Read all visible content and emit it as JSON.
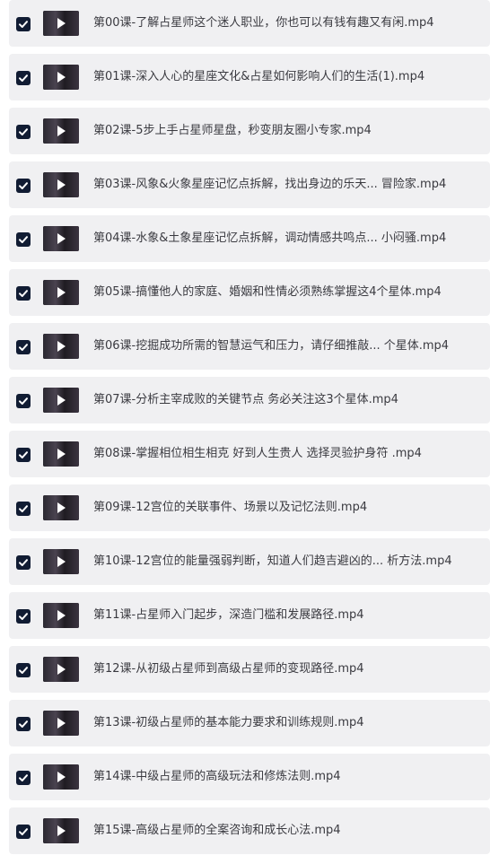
{
  "files": [
    {
      "name": "第00课-了解占星师这个迷人职业，你也可以有钱有趣又有闲.mp4",
      "checked": true
    },
    {
      "name": "第01课-深入人心的星座文化&占星如何影响人们的生活(1).mp4",
      "checked": true
    },
    {
      "name": "第02课-5步上手占星师星盘，秒变朋友圈小专家.mp4",
      "checked": true
    },
    {
      "name": "第03课-风象&火象星座记忆点拆解，找出身边的乐天... 冒险家.mp4",
      "checked": true
    },
    {
      "name": "第04课-水象&土象星座记忆点拆解，调动情感共鸣点... 小闷骚.mp4",
      "checked": true
    },
    {
      "name": "第05课-搞懂他人的家庭、婚姻和性情必须熟练掌握这4个星体.mp4",
      "checked": true
    },
    {
      "name": "第06课-挖掘成功所需的智慧运气和压力，请仔细推敲... 个星体.mp4",
      "checked": true
    },
    {
      "name": "第07课-分析主宰成败的关键节点 务必关注这3个星体.mp4",
      "checked": true
    },
    {
      "name": "第08课-掌握相位相生相克 好到人生贵人 选择灵验护身符 .mp4",
      "checked": true
    },
    {
      "name": "第09课-12宫位的关联事件、场景以及记忆法则.mp4",
      "checked": true
    },
    {
      "name": "第10课-12宫位的能量强弱判断，知道人们趋吉避凶的... 析方法.mp4",
      "checked": true
    },
    {
      "name": "第11课-占星师入门起步，深造门槛和发展路径.mp4",
      "checked": true
    },
    {
      "name": "第12课-从初级占星师到高级占星师的变现路径.mp4",
      "checked": true
    },
    {
      "name": "第13课-初级占星师的基本能力要求和训练规则.mp4",
      "checked": true
    },
    {
      "name": "第14课-中级占星师的高级玩法和修炼法则.mp4",
      "checked": true
    },
    {
      "name": "第15课-高级占星师的全案咨询和成长心法.mp4",
      "checked": true
    }
  ],
  "colors": {
    "row_bg": "#f0f0f2",
    "checkbox_bg": "#111c33",
    "text": "#3a3a40"
  },
  "icons": {
    "checkbox": "checkmark-icon",
    "thumbnail_overlay": "play-icon"
  }
}
